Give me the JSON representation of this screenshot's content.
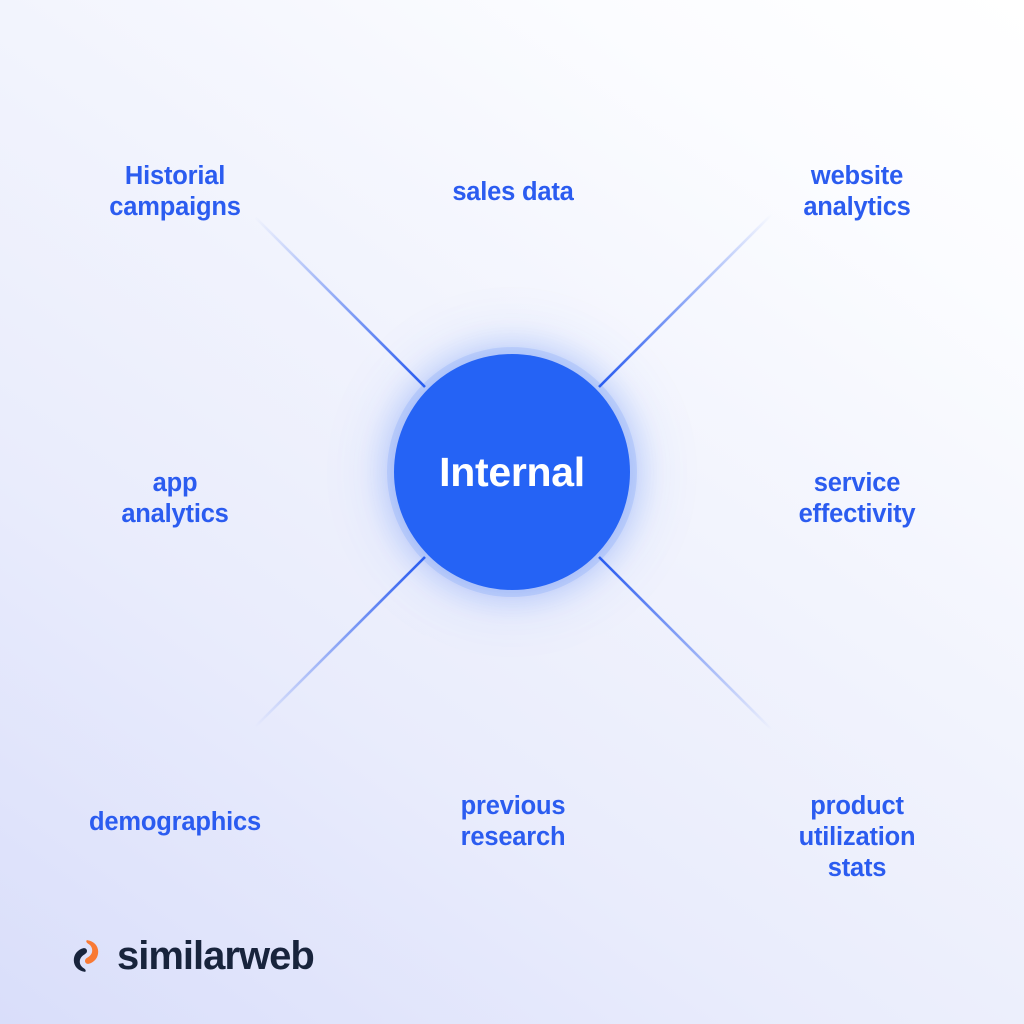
{
  "diagram": {
    "title": "Internal data sources hub-and-spoke diagram",
    "hub": {
      "label": "Internal",
      "color": "#2563f5",
      "text_color": "#ffffff"
    },
    "node_color": "#2b5cf0",
    "spoke_color": "#2b5cf0",
    "background": {
      "from": "#ffffff",
      "to": "#d9defa"
    },
    "nodes": [
      {
        "id": "historial-campaigns",
        "label": "Historial\ncampaigns",
        "angle_deg": 135
      },
      {
        "id": "sales-data",
        "label": "sales data",
        "angle_deg": 90
      },
      {
        "id": "website-analytics",
        "label": "website\nanalytics",
        "angle_deg": 45
      },
      {
        "id": "service-effectivity",
        "label": "service\neffectivity",
        "angle_deg": 0
      },
      {
        "id": "product-utilization-stats",
        "label": "product\nutilization stats",
        "angle_deg": 315
      },
      {
        "id": "previous-research",
        "label": "previous\nresearch",
        "angle_deg": 270
      },
      {
        "id": "demographics",
        "label": "demographics",
        "angle_deg": 225
      },
      {
        "id": "app-analytics",
        "label": "app\nanalytics",
        "angle_deg": 180
      }
    ]
  },
  "brand": {
    "name": "similarweb",
    "mark_name": "similarweb-logo-mark",
    "text_color": "#18243c",
    "accent_color": "#f97a34"
  }
}
